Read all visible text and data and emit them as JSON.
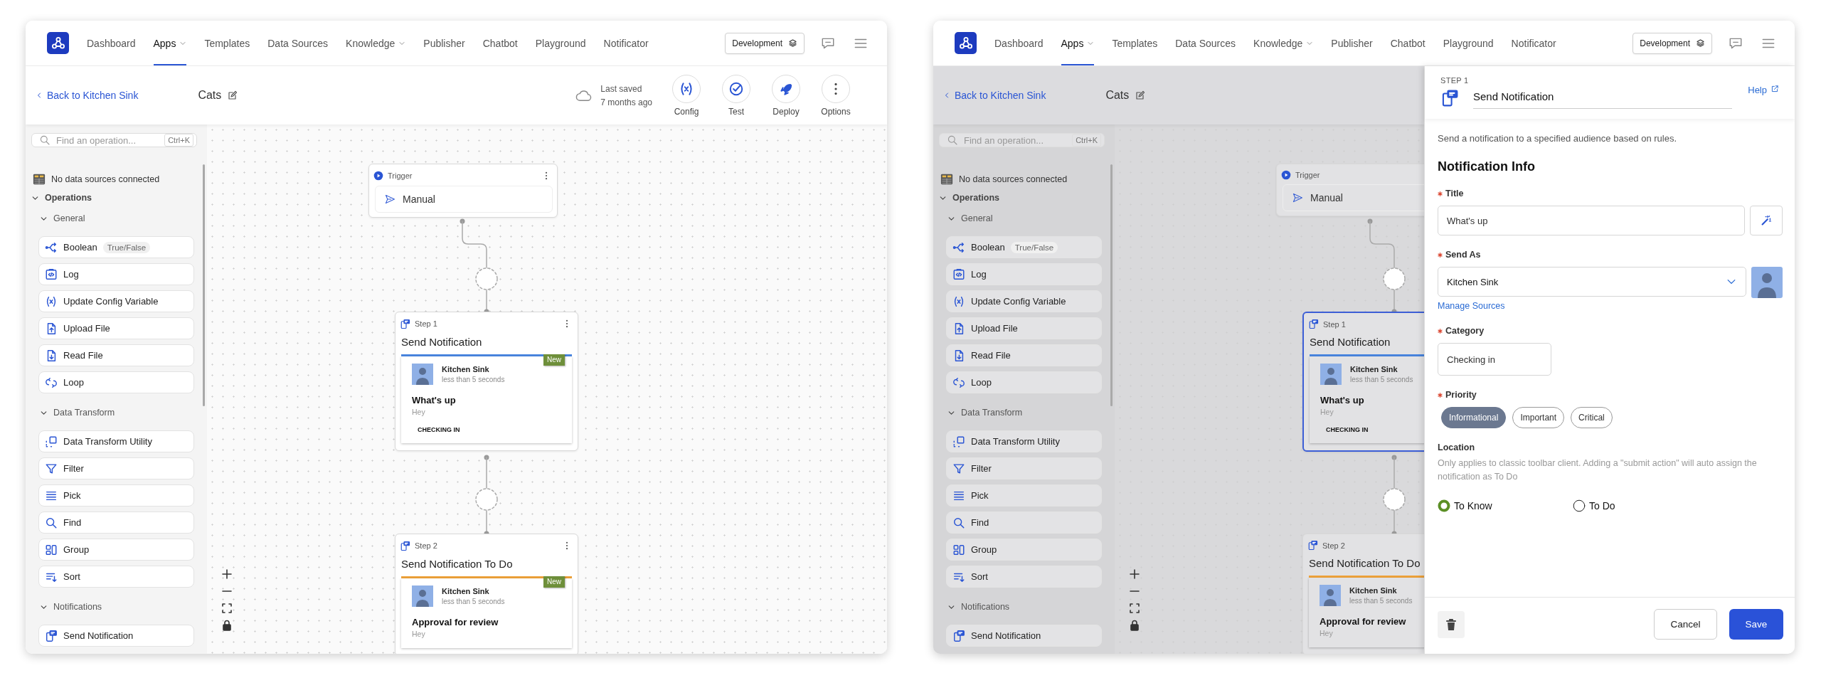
{
  "windows": [
    {
      "nav": {
        "items": [
          {
            "label": "Dashboard",
            "selected": false,
            "dropdown": false
          },
          {
            "label": "Apps",
            "selected": true,
            "dropdown": true
          },
          {
            "label": "Templates",
            "selected": false,
            "dropdown": false
          },
          {
            "label": "Data Sources",
            "selected": false,
            "dropdown": false
          },
          {
            "label": "Knowledge",
            "selected": false,
            "dropdown": true
          },
          {
            "label": "Publisher",
            "selected": false,
            "dropdown": false
          },
          {
            "label": "Chatbot",
            "selected": false,
            "dropdown": false
          },
          {
            "label": "Playground",
            "selected": false,
            "dropdown": false
          },
          {
            "label": "Notificator",
            "selected": false,
            "dropdown": false
          }
        ],
        "environment": "Development"
      },
      "header": {
        "back": "Back to Kitchen Sink",
        "name": "Cats",
        "saved": "Last saved",
        "saved_when": "7 months ago",
        "actions": [
          {
            "label": "Config"
          },
          {
            "label": "Test"
          },
          {
            "label": "Deploy"
          },
          {
            "label": "Options"
          }
        ]
      },
      "dimmed": false,
      "sidebar": {
        "search": {
          "placeholder": "Find an operation...",
          "shortcut": "Ctrl+K"
        },
        "data_sources": "No data sources connected",
        "tree": [
          {
            "label": "Operations",
            "expanded": true,
            "children": [
              {
                "label": "General",
                "expanded": true,
                "children": [
                  {
                    "label": "Boolean",
                    "tag": "True/False"
                  },
                  {
                    "label": "Log"
                  },
                  {
                    "label": "Update Config Variable"
                  },
                  {
                    "label": "Upload File"
                  },
                  {
                    "label": "Read File"
                  },
                  {
                    "label": "Loop"
                  }
                ]
              },
              {
                "label": "Data Transform",
                "expanded": true,
                "children": [
                  {
                    "label": "Data Transform Utility"
                  },
                  {
                    "label": "Filter"
                  },
                  {
                    "label": "Pick"
                  },
                  {
                    "label": "Find"
                  },
                  {
                    "label": "Group"
                  },
                  {
                    "label": "Sort"
                  }
                ]
              },
              {
                "label": "Notifications",
                "expanded": true,
                "children": [
                  {
                    "label": "Send Notification"
                  }
                ]
              }
            ]
          }
        ]
      },
      "canvas": {
        "nodes": [
          {
            "kind": "trigger",
            "label": "Trigger",
            "value": "Manual"
          },
          {
            "kind": "step",
            "step": "Step 1",
            "title": "Send Notification",
            "color": "#4a86e0",
            "badge": "New",
            "selected": false,
            "preview": {
              "sender": "Kitchen Sink",
              "time": "less than 5 seconds",
              "title": "What's up",
              "body": "Hey",
              "category": "CHECKING IN"
            }
          },
          {
            "kind": "step",
            "step": "Step 2",
            "title": "Send Notification To Do",
            "color": "#eea23a",
            "badge": "New",
            "selected": false,
            "preview": {
              "sender": "Kitchen Sink",
              "time": "less than 5 seconds",
              "title": "Approval for review",
              "body": "Hey"
            }
          }
        ]
      }
    },
    {
      "nav": {
        "items": [
          {
            "label": "Dashboard",
            "selected": false,
            "dropdown": false
          },
          {
            "label": "Apps",
            "selected": true,
            "dropdown": true
          },
          {
            "label": "Templates",
            "selected": false,
            "dropdown": false
          },
          {
            "label": "Data Sources",
            "selected": false,
            "dropdown": false
          },
          {
            "label": "Knowledge",
            "selected": false,
            "dropdown": true
          },
          {
            "label": "Publisher",
            "selected": false,
            "dropdown": false
          },
          {
            "label": "Chatbot",
            "selected": false,
            "dropdown": false
          },
          {
            "label": "Playground",
            "selected": false,
            "dropdown": false
          },
          {
            "label": "Notificator",
            "selected": false,
            "dropdown": false
          }
        ],
        "environment": "Development"
      },
      "header": {
        "back": "Back to Kitchen Sink",
        "name": "Cats"
      },
      "dimmed": true,
      "sidebar": {
        "search": {
          "placeholder": "Find an operation...",
          "shortcut": "Ctrl+K"
        },
        "data_sources": "No data sources connected",
        "tree": [
          {
            "label": "Operations",
            "expanded": true,
            "children": [
              {
                "label": "General",
                "expanded": true,
                "children": [
                  {
                    "label": "Boolean",
                    "tag": "True/False"
                  },
                  {
                    "label": "Log"
                  },
                  {
                    "label": "Update Config Variable"
                  },
                  {
                    "label": "Upload File"
                  },
                  {
                    "label": "Read File"
                  },
                  {
                    "label": "Loop"
                  }
                ]
              },
              {
                "label": "Data Transform",
                "expanded": true,
                "children": [
                  {
                    "label": "Data Transform Utility"
                  },
                  {
                    "label": "Filter"
                  },
                  {
                    "label": "Pick"
                  },
                  {
                    "label": "Find"
                  },
                  {
                    "label": "Group"
                  },
                  {
                    "label": "Sort"
                  }
                ]
              },
              {
                "label": "Notifications",
                "expanded": true,
                "children": [
                  {
                    "label": "Send Notification"
                  }
                ]
              }
            ]
          }
        ]
      },
      "canvas": {
        "nodes": [
          {
            "kind": "trigger",
            "label": "Trigger",
            "value": "Manual"
          },
          {
            "kind": "step",
            "step": "Step 1",
            "title": "Send Notification",
            "color": "#4a86e0",
            "selected": true,
            "preview": {
              "sender": "Kitchen Sink",
              "time": "less than 5 seconds",
              "title": "What's up",
              "body": "Hey",
              "category": "CHECKING IN"
            }
          },
          {
            "kind": "step",
            "step": "Step 2",
            "title": "Send Notification To Do",
            "color": "#eea23a",
            "selected": false,
            "preview": {
              "sender": "Kitchen Sink",
              "time": "less than 5 seconds",
              "title": "Approval for review",
              "body": "Hey"
            }
          }
        ]
      },
      "panel": {
        "step": "STEP 1",
        "title": "Send Notification",
        "help": "Help",
        "description": "Send a notification to a specified audience based on rules.",
        "heading": "Notification Info",
        "fields": [
          {
            "kind": "text",
            "label": "Title",
            "required": true,
            "value": "What's up"
          },
          {
            "kind": "select",
            "label": "Send As",
            "required": true,
            "value": "Kitchen Sink",
            "link": "Manage Sources"
          },
          {
            "kind": "short",
            "label": "Category",
            "required": true,
            "value": "Checking in"
          },
          {
            "kind": "chips",
            "label": "Priority",
            "required": true,
            "options": [
              {
                "label": "Informational",
                "selected": true
              },
              {
                "label": "Important",
                "selected": false
              },
              {
                "label": "Critical",
                "selected": false
              }
            ]
          },
          {
            "kind": "radios",
            "label": "Location",
            "help": "Only applies to classic toolbar client. Adding a \"submit action\" will auto assign the notification as To Do",
            "options": [
              {
                "label": "To Know",
                "selected": true
              },
              {
                "label": "To Do",
                "selected": false
              }
            ]
          }
        ],
        "cancel": "Cancel",
        "save": "Save"
      }
    }
  ]
}
